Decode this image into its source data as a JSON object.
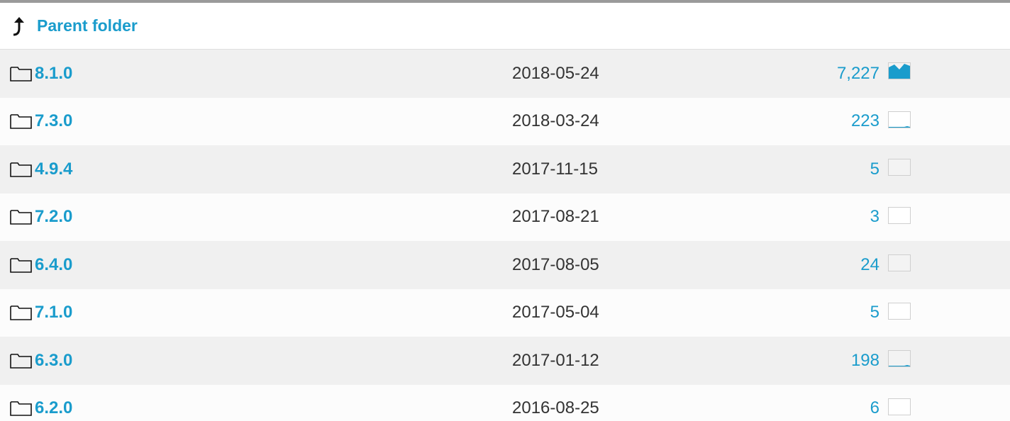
{
  "parent": {
    "label": "Parent folder",
    "icon": "arrow-up-turn-icon"
  },
  "accent_color": "#1a9ccc",
  "folders": [
    {
      "name": "8.1.0",
      "date": "2018-05-24",
      "downloads": "7,227",
      "activity": 1.0
    },
    {
      "name": "7.3.0",
      "date": "2018-03-24",
      "downloads": "223",
      "activity": 0.05
    },
    {
      "name": "4.9.4",
      "date": "2017-11-15",
      "downloads": "5",
      "activity": 0
    },
    {
      "name": "7.2.0",
      "date": "2017-08-21",
      "downloads": "3",
      "activity": 0
    },
    {
      "name": "6.4.0",
      "date": "2017-08-05",
      "downloads": "24",
      "activity": 0
    },
    {
      "name": "7.1.0",
      "date": "2017-05-04",
      "downloads": "5",
      "activity": 0
    },
    {
      "name": "6.3.0",
      "date": "2017-01-12",
      "downloads": "198",
      "activity": 0.05
    },
    {
      "name": "6.2.0",
      "date": "2016-08-25",
      "downloads": "6",
      "activity": 0
    }
  ]
}
